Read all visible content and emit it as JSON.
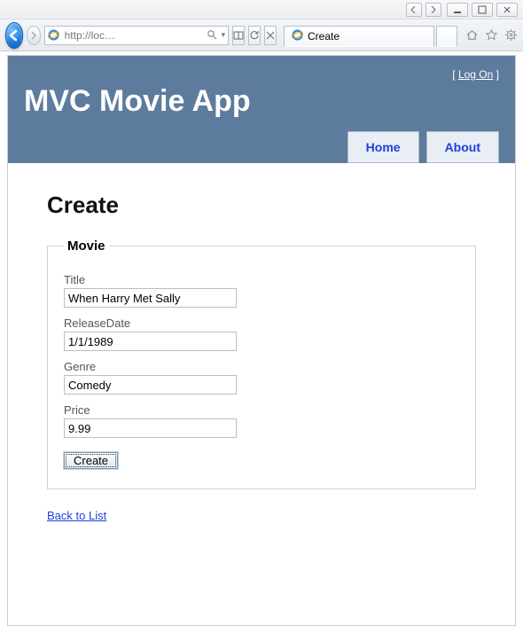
{
  "browser": {
    "address": "http://loc…",
    "tabTitle": "Create"
  },
  "app": {
    "logonText": "Log On",
    "title": "MVC Movie App",
    "nav": {
      "home": "Home",
      "about": "About"
    }
  },
  "page": {
    "heading": "Create",
    "legend": "Movie",
    "fields": {
      "title": {
        "label": "Title",
        "value": "When Harry Met Sally"
      },
      "releaseDate": {
        "label": "ReleaseDate",
        "value": "1/1/1989"
      },
      "genre": {
        "label": "Genre",
        "value": "Comedy"
      },
      "price": {
        "label": "Price",
        "value": "9.99"
      }
    },
    "submitLabel": "Create",
    "backLink": "Back to List"
  }
}
